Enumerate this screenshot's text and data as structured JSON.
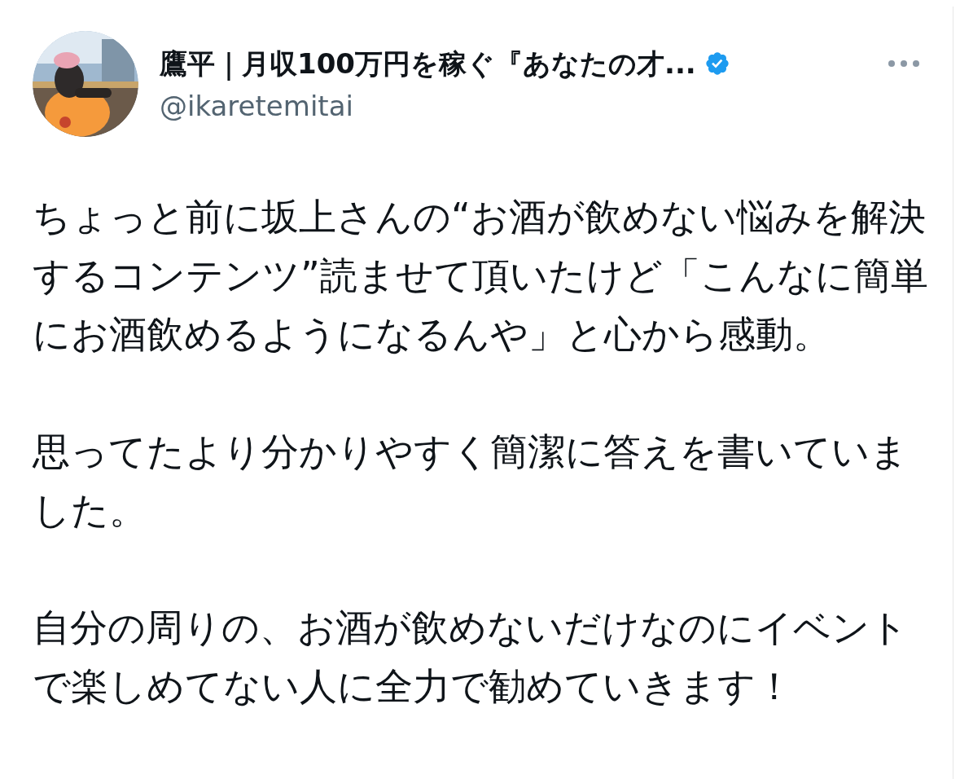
{
  "author": {
    "name": "鷹平｜月収100万円を稼ぐ『あなたの才...",
    "handle": "@ikaretemitai",
    "verified": true
  },
  "paragraphs": [
    "ちょっと前に坂上さんの“お酒が飲めない悩みを解決するコンテンツ”読ませて頂いたけど「こんなに簡単にお酒飲めるようになるんや」と心から感動。",
    "思ってたより分かりやすく簡潔に答えを書いていました。",
    "自分の周りの、お酒が飲めないだけなのにイベントで楽しめてない人に全力で勧めていきます！"
  ]
}
